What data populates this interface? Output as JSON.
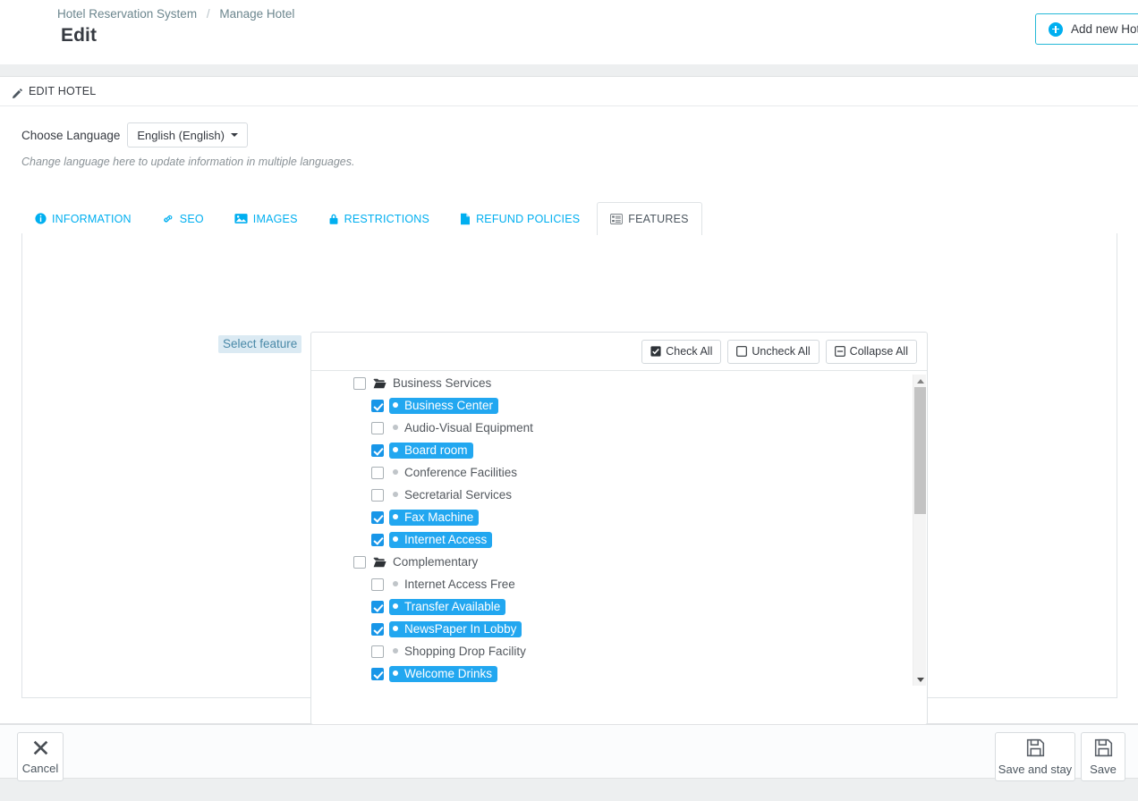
{
  "header": {
    "breadcrumb": [
      "Hotel Reservation System",
      "Manage Hotel"
    ],
    "separator": "/",
    "title": "Edit",
    "add_button": {
      "label": "Add new Hotel",
      "icon": "plus-circle-icon",
      "accent": "#00aff0"
    }
  },
  "panel": {
    "heading": "EDIT HOTEL",
    "heading_icon": "pencil-icon",
    "language": {
      "label": "Choose Language",
      "selected": "English (English)",
      "hint": "Change language here to update information in multiple languages."
    }
  },
  "tabs": [
    {
      "label": "INFORMATION",
      "icon": "info-circle-icon",
      "active": false
    },
    {
      "label": "SEO",
      "icon": "link-icon",
      "active": false
    },
    {
      "label": "IMAGES",
      "icon": "image-icon",
      "active": false
    },
    {
      "label": "RESTRICTIONS",
      "icon": "lock-icon",
      "active": false
    },
    {
      "label": "REFUND POLICIES",
      "icon": "file-icon",
      "active": false
    },
    {
      "label": "FEATURES",
      "icon": "list-alt-icon",
      "active": true
    }
  ],
  "features_tab": {
    "select_feature_label": "Select feature",
    "toolbar": [
      {
        "label": "Check All",
        "icon": "checked-box-icon"
      },
      {
        "label": "Uncheck All",
        "icon": "empty-box-icon"
      },
      {
        "label": "Collapse All",
        "icon": "minus-square-icon"
      }
    ],
    "tree": [
      {
        "label": "Business Services",
        "type": "folder",
        "icon": "open-folder-icon",
        "checked": false,
        "children": [
          {
            "label": "Business Center",
            "checked": true
          },
          {
            "label": "Audio-Visual Equipment",
            "checked": false
          },
          {
            "label": "Board room",
            "checked": true
          },
          {
            "label": "Conference Facilities",
            "checked": false
          },
          {
            "label": "Secretarial Services",
            "checked": false
          },
          {
            "label": "Fax Machine",
            "checked": true
          },
          {
            "label": "Internet Access",
            "checked": true
          }
        ]
      },
      {
        "label": "Complementary",
        "type": "folder",
        "icon": "open-folder-icon",
        "checked": false,
        "children": [
          {
            "label": "Internet Access Free",
            "checked": false
          },
          {
            "label": "Transfer Available",
            "checked": true
          },
          {
            "label": "NewsPaper In Lobby",
            "checked": true
          },
          {
            "label": "Shopping Drop Facility",
            "checked": false
          },
          {
            "label": "Welcome Drinks",
            "checked": true
          }
        ]
      }
    ],
    "selected_highlight_color": "#22a7f0",
    "checkbox_color": "#1896e8"
  },
  "footer": {
    "cancel": {
      "label": "Cancel",
      "icon": "x-icon"
    },
    "save_and_stay": {
      "label": "Save and stay",
      "icon": "floppy-icon"
    },
    "save": {
      "label": "Save",
      "icon": "floppy-icon"
    }
  }
}
